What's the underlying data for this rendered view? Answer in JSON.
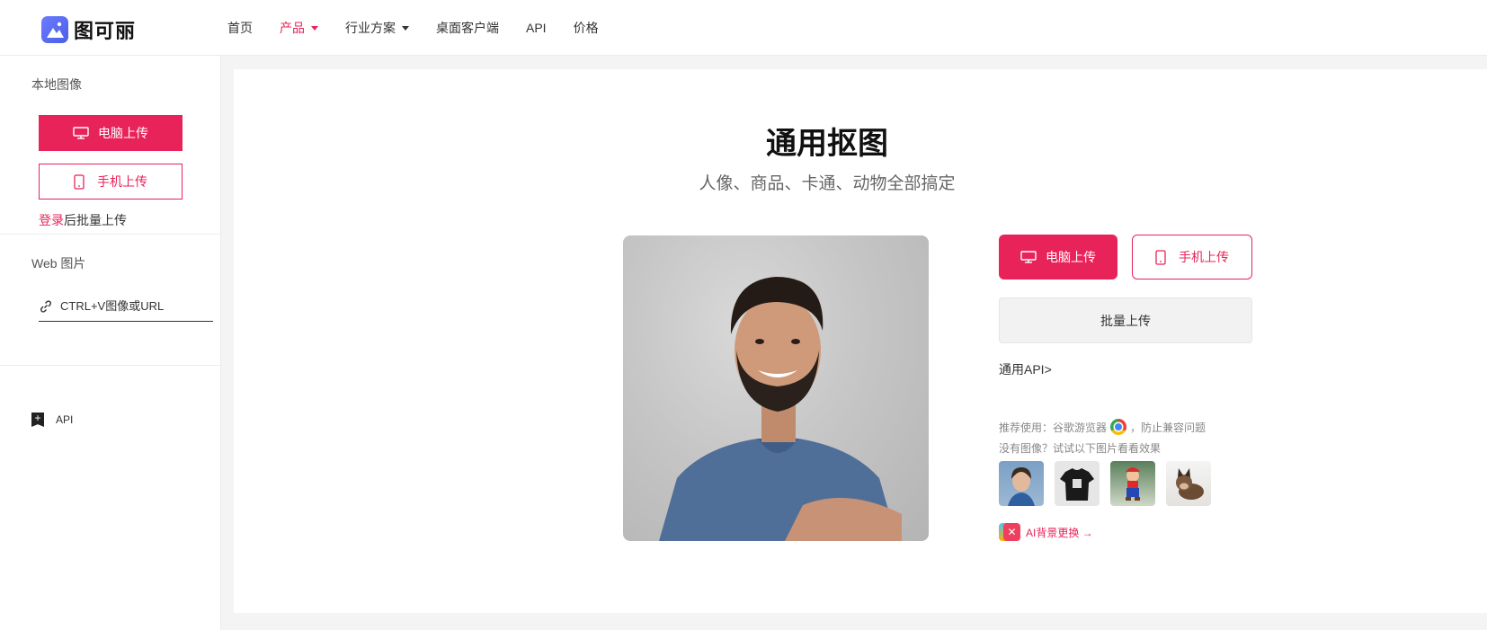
{
  "brand": {
    "name": "图可丽"
  },
  "nav": [
    {
      "label": "首页"
    },
    {
      "label": "产品"
    },
    {
      "label": "行业方案"
    },
    {
      "label": "桌面客户端"
    },
    {
      "label": "API"
    },
    {
      "label": "价格"
    }
  ],
  "sidebar": {
    "local_label": "本地图像",
    "pc_upload": "电脑上传",
    "mobile_upload": "手机上传",
    "login_link": "登录",
    "login_suffix": "后批量上传",
    "web_label": "Web 图片",
    "url_placeholder": "CTRL+V图像或URL",
    "api_label": "API"
  },
  "main": {
    "title": "通用抠图",
    "subtitle": "人像、商品、卡通、动物全部搞定",
    "pc_upload": "电脑上传",
    "mobile_upload": "手机上传",
    "batch_upload": "批量上传",
    "api_link": "通用API>",
    "recommend_prefix": "推荐使用：谷歌游览器",
    "recommend_suffix": "，防止兼容问题",
    "no_image_hint": "没有图像？试试以下图片看看效果",
    "ai_link": "AI背景更换 →"
  },
  "colors": {
    "accent": "#e8235a"
  }
}
